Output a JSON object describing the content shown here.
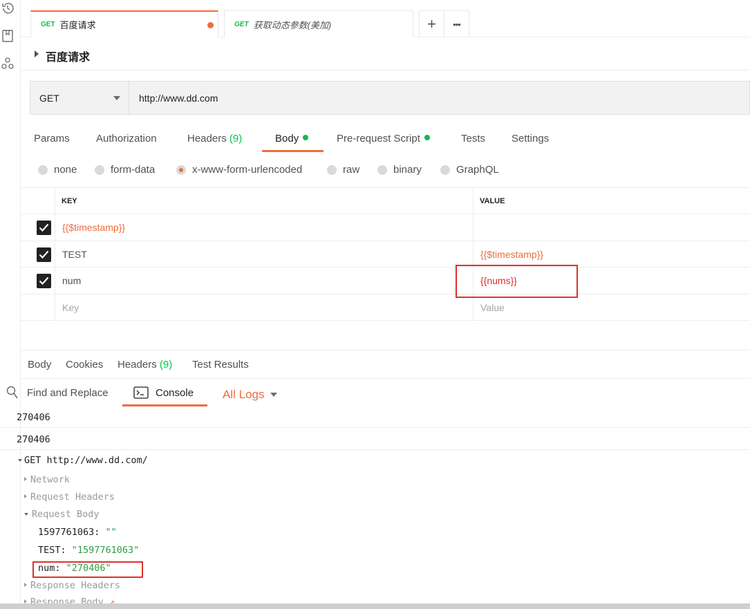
{
  "tabs": [
    {
      "method": "GET",
      "name": "百度请求",
      "unsaved": true,
      "active": true
    },
    {
      "method": "GET",
      "name": "获取动态参数(美加)",
      "unsaved": false,
      "active": false
    }
  ],
  "tab_actions": {
    "add": "+",
    "more": "•••"
  },
  "request": {
    "title": "百度请求",
    "method": "GET",
    "url": "http://www.dd.com"
  },
  "request_tabs": {
    "params": "Params",
    "authorization": "Authorization",
    "headers": "Headers",
    "headers_count": "(9)",
    "body": "Body",
    "prerequest": "Pre-request Script",
    "tests": "Tests",
    "settings": "Settings"
  },
  "body_types": [
    "none",
    "form-data",
    "x-www-form-urlencoded",
    "raw",
    "binary",
    "GraphQL"
  ],
  "body_type_selected": "x-www-form-urlencoded",
  "table": {
    "key_header": "KEY",
    "value_header": "VALUE",
    "rows": [
      {
        "key": "{{$timestamp}}",
        "value": "",
        "checked": true
      },
      {
        "key": "TEST",
        "value": "{{$timestamp}}",
        "checked": true
      },
      {
        "key": "num",
        "value": "{{nums}}",
        "checked": true
      }
    ],
    "key_placeholder": "Key",
    "value_placeholder": "Value"
  },
  "response_tabs": {
    "body": "Body",
    "cookies": "Cookies",
    "headers": "Headers",
    "headers_count": "(9)",
    "test_results": "Test Results"
  },
  "console_bar": {
    "find_replace": "Find and Replace",
    "console": "Console",
    "all_logs": "All Logs"
  },
  "console_log": {
    "line1": "270406",
    "line2": "270406",
    "request_line": "GET http://www.dd.com/",
    "network": "Network",
    "request_headers": "Request Headers",
    "request_body": "Request Body",
    "body_entries": [
      {
        "key": "1597761063:",
        "value": "\"\""
      },
      {
        "key": "TEST:",
        "value": "\"1597761063\""
      },
      {
        "key": "num:",
        "value": "\"270406\""
      }
    ],
    "response_headers": "Response Headers",
    "response_body": "Response Body"
  },
  "colors": {
    "accent": "#f26b3a",
    "green": "#0cbb52",
    "highlight_red": "#e0302a"
  }
}
